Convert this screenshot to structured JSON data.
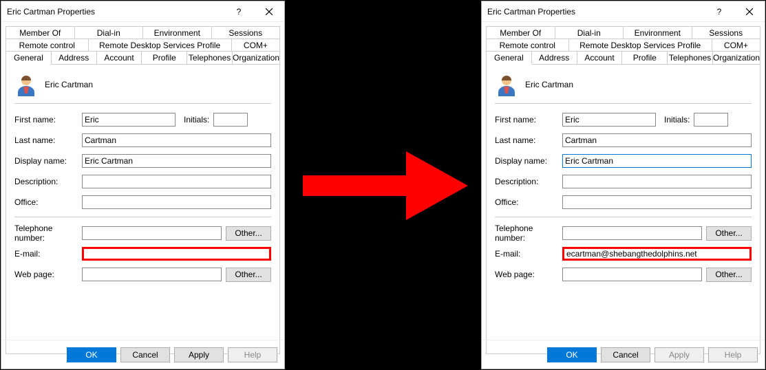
{
  "window": {
    "title": "Eric Cartman Properties",
    "help_tooltip": "?",
    "close_tooltip": "Close"
  },
  "tabs_row1": [
    "Member Of",
    "Dial-in",
    "Environment",
    "Sessions"
  ],
  "tabs_row2": [
    "Remote control",
    "Remote Desktop Services Profile",
    "COM+"
  ],
  "tabs_row3": [
    "General",
    "Address",
    "Account",
    "Profile",
    "Telephones",
    "Organization"
  ],
  "active_tab": "General",
  "header_name": "Eric Cartman",
  "labels": {
    "first_name": "First name:",
    "initials": "Initials:",
    "last_name": "Last name:",
    "display_name": "Display name:",
    "description": "Description:",
    "office": "Office:",
    "telephone": "Telephone number:",
    "email": "E-mail:",
    "web": "Web page:"
  },
  "buttons": {
    "other": "Other...",
    "ok": "OK",
    "cancel": "Cancel",
    "apply": "Apply",
    "help": "Help"
  },
  "left": {
    "first_name": "Eric",
    "initials": "",
    "last_name": "Cartman",
    "display_name": "Eric Cartman",
    "description": "",
    "office": "",
    "telephone": "",
    "email": "",
    "web": ""
  },
  "right": {
    "first_name": "Eric",
    "initials": "",
    "last_name": "Cartman",
    "display_name": "Eric Cartman",
    "description": "",
    "office": "",
    "telephone": "",
    "email": "ecartman@shebangthedolphins.net",
    "web": ""
  }
}
